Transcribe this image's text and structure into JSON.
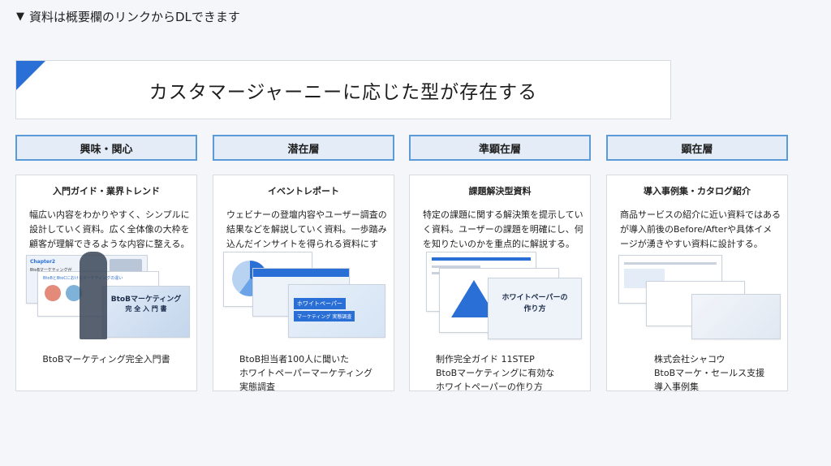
{
  "note": {
    "marker": "▼",
    "text": "資料は概要欄のリンクからDLできます"
  },
  "headline": "カスタマージャーニーに応じた型が存在する",
  "stages": [
    {
      "label": "興味・関心"
    },
    {
      "label": "潜在層"
    },
    {
      "label": "準顕在層"
    },
    {
      "label": "顕在層"
    }
  ],
  "cards": [
    {
      "title": "入門ガイド・業界トレンド",
      "description": "幅広い内容をわかりやすく、シンプルに設計していく資料。広く全体像の大枠を顧客が理解できるような内容に整える。",
      "thumb_texts": [
        "Chapter2",
        "BtoBマーケティングが",
        "BtoBとBtoCにおけるマーケティングの違い",
        "BtoBマーケティング",
        "完 全 入 門 書"
      ],
      "caption": [
        "BtoBマーケティング完全入門書"
      ]
    },
    {
      "title": "イベントレポート",
      "description": "ウェビナーの登壇内容やユーザー調査の結果などを解説していく資料。一歩踏み込んだインサイトを得られる資料にする。",
      "thumb_texts": [
        "ホワイトペーパー",
        "マーケティング 実態調査"
      ],
      "caption": [
        "BtoB担当者100人に聞いた",
        "ホワイトペーパーマーケティング",
        "実態調査"
      ]
    },
    {
      "title": "課題解決型資料",
      "description": "特定の課題に関する解決策を提示していく資料。ユーザーの課題を明確にし、何を知りたいのかを重点的に解説する。",
      "thumb_texts": [
        "ホワイトペーパーの",
        "作り方"
      ],
      "caption": [
        "制作完全ガイド 11STEP",
        "BtoBマーケティングに有効な",
        "ホワイトペーパーの作り方"
      ]
    },
    {
      "title": "導入事例集・カタログ紹介",
      "description": "商品サービスの紹介に近い資料ではあるが導入前後のBefore/Afterや具体イメージが湧きやすい資料に設計する。",
      "thumb_texts": [],
      "caption": [
        "株式会社シャコウ",
        "BtoBマーケ・セールス支援",
        "導入事例集"
      ]
    }
  ],
  "colors": {
    "accent": "#2a6fd6",
    "stage_bg": "#e3ecf7",
    "stage_border": "#5b9bd8"
  }
}
